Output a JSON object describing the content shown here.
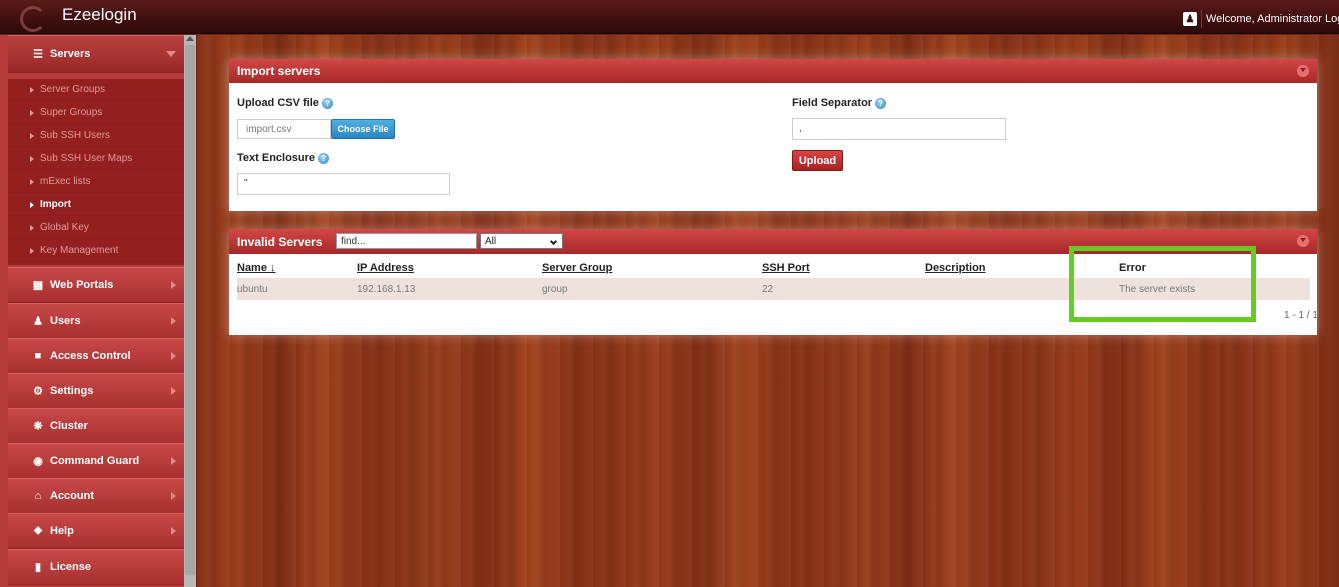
{
  "app": {
    "title": "Ezeelogin"
  },
  "topbar": {
    "welcome": "Welcome, Administrator Logout"
  },
  "sidebar": {
    "servers_header": "Servers",
    "submenu": [
      {
        "label": "Server Groups"
      },
      {
        "label": "Super Groups"
      },
      {
        "label": "Sub SSH Users"
      },
      {
        "label": "Sub SSH User Maps"
      },
      {
        "label": "mExec lists"
      },
      {
        "label": "Import"
      },
      {
        "label": "Global Key"
      },
      {
        "label": "Key Management"
      }
    ],
    "sections": [
      {
        "label": "Web Portals"
      },
      {
        "label": "Users"
      },
      {
        "label": "Access Control"
      },
      {
        "label": "Settings"
      },
      {
        "label": "Cluster"
      },
      {
        "label": "Command Guard"
      },
      {
        "label": "Account"
      },
      {
        "label": "Help"
      },
      {
        "label": "License"
      }
    ]
  },
  "import_panel": {
    "title": "Import servers",
    "upload_csv_label": "Upload CSV file",
    "file_name": "import.csv",
    "choose_file": "Choose File",
    "text_enclosure_label": "Text Enclosure",
    "text_enclosure_value": "\"",
    "field_separator_label": "Field Separator",
    "field_separator_value": ",",
    "upload_button": "Upload"
  },
  "invalid_panel": {
    "title": "Invalid Servers",
    "find_placeholder": "find...",
    "filter_value": "All",
    "columns": {
      "name": "Name ↓",
      "ip": "IP Address",
      "group": "Server Group",
      "port": "SSH Port",
      "description": "Description",
      "error": "Error"
    },
    "rows": [
      {
        "name": "ubuntu",
        "ip": "192.168.1.13",
        "group": "group",
        "port": "22",
        "description": "",
        "error": "The server exists"
      }
    ],
    "pager": "1 - 1 / 1"
  },
  "colors": {
    "accent_red": "#c23a3a",
    "highlight_green": "#66cc22",
    "help_blue": "#2a86c8"
  }
}
